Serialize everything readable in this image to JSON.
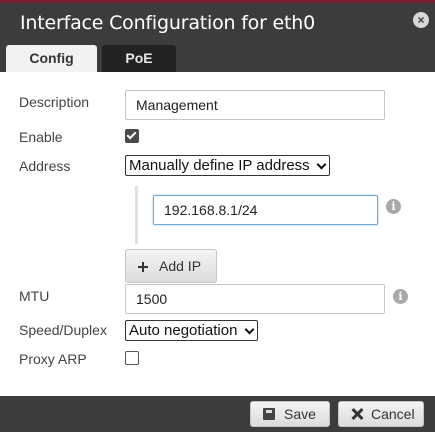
{
  "dialog": {
    "title": "Interface Configuration for eth0",
    "close_icon": "close-icon"
  },
  "tabs": [
    {
      "label": "Config",
      "active": true
    },
    {
      "label": "PoE",
      "active": false
    }
  ],
  "form": {
    "description": {
      "label": "Description",
      "value": "Management"
    },
    "enable": {
      "label": "Enable",
      "checked": true
    },
    "address": {
      "label": "Address",
      "selected": "Manually define IP address"
    },
    "ip": {
      "value": "192.168.8.1/24"
    },
    "add_ip_label": "Add IP",
    "mtu": {
      "label": "MTU",
      "value": "1500"
    },
    "speed_duplex": {
      "label": "Speed/Duplex",
      "selected": "Auto negotiation"
    },
    "proxy_arp": {
      "label": "Proxy ARP",
      "checked": false
    }
  },
  "footer": {
    "save_label": "Save",
    "cancel_label": "Cancel"
  },
  "colors": {
    "titlebar": "#3c3c3c",
    "accent_line": "#7a2030",
    "focus_border": "#6ea8d8"
  }
}
